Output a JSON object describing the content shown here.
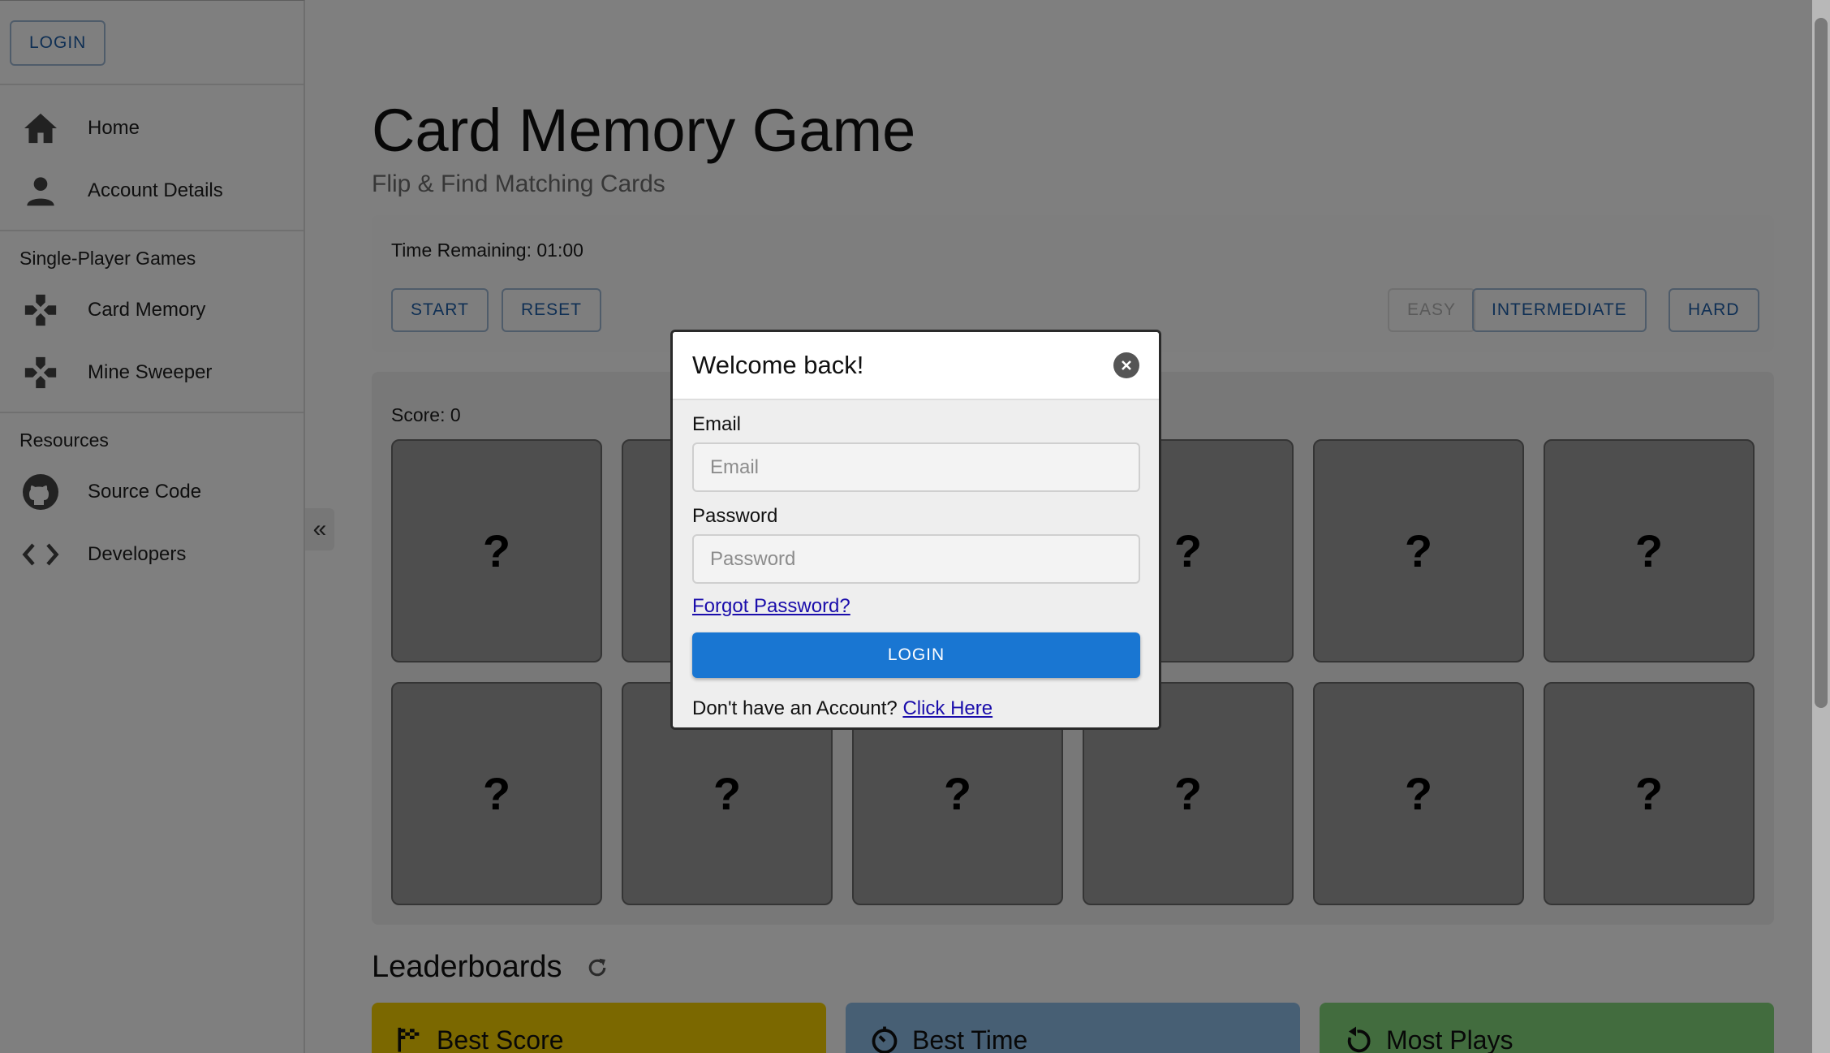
{
  "sidebar": {
    "login_label": "LOGIN",
    "nav": [
      {
        "label": "Home",
        "icon": "home-icon"
      },
      {
        "label": "Account Details",
        "icon": "person-icon"
      }
    ],
    "games_title": "Single-Player Games",
    "games": [
      {
        "label": "Card Memory",
        "icon": "gamepad-icon"
      },
      {
        "label": "Mine Sweeper",
        "icon": "gamepad-icon"
      }
    ],
    "resources_title": "Resources",
    "resources": [
      {
        "label": "Source Code",
        "icon": "github-icon"
      },
      {
        "label": "Developers",
        "icon": "code-icon"
      }
    ],
    "collapse_glyph": "«"
  },
  "main": {
    "title": "Card Memory Game",
    "subtitle": "Flip & Find Matching Cards",
    "time_remaining": "Time Remaining: 01:00",
    "buttons": {
      "start": "START",
      "reset": "RESET"
    },
    "difficulty": {
      "easy": "EASY",
      "intermediate": "INTERMEDIATE",
      "hard": "HARD",
      "selected": "EASY"
    },
    "score": "Score: 0",
    "cards": [
      "?",
      "?",
      "?",
      "?",
      "?",
      "?",
      "?",
      "?",
      "?",
      "?",
      "?",
      "?"
    ],
    "leaderboards": {
      "title": "Leaderboards",
      "cards": [
        {
          "label": "Best Score",
          "color": "#f7d100",
          "icon": "checkered-flag-icon"
        },
        {
          "label": "Best Time",
          "color": "#8fbfe9",
          "icon": "timer-icon"
        },
        {
          "label": "Most Plays",
          "color": "#84d87d",
          "icon": "replay-icon"
        }
      ]
    }
  },
  "modal": {
    "title": "Welcome back!",
    "email_label": "Email",
    "email_placeholder": "Email",
    "password_label": "Password",
    "password_placeholder": "Password",
    "forgot": "Forgot Password?",
    "login_button": "LOGIN",
    "no_account": "Don't have an Account?",
    "click_here": "Click Here"
  },
  "colors": {
    "accent": "#1976d2",
    "outline_button": "#1e5fa8",
    "card_back": "#9c9c9c"
  }
}
